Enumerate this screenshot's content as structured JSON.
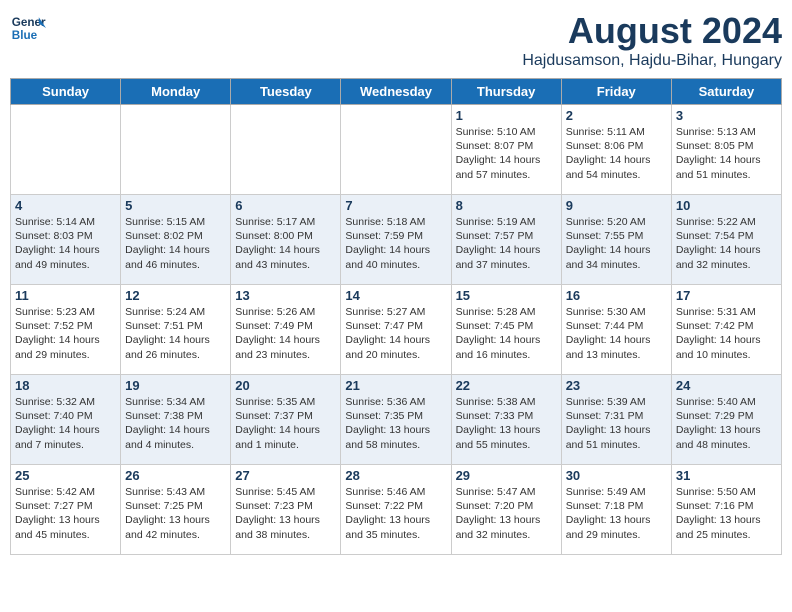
{
  "header": {
    "logo_line1": "General",
    "logo_line2": "Blue",
    "month_title": "August 2024",
    "location": "Hajdusamson, Hajdu-Bihar, Hungary"
  },
  "weekdays": [
    "Sunday",
    "Monday",
    "Tuesday",
    "Wednesday",
    "Thursday",
    "Friday",
    "Saturday"
  ],
  "weeks": [
    [
      {
        "day": "",
        "content": ""
      },
      {
        "day": "",
        "content": ""
      },
      {
        "day": "",
        "content": ""
      },
      {
        "day": "",
        "content": ""
      },
      {
        "day": "1",
        "content": "Sunrise: 5:10 AM\nSunset: 8:07 PM\nDaylight: 14 hours\nand 57 minutes."
      },
      {
        "day": "2",
        "content": "Sunrise: 5:11 AM\nSunset: 8:06 PM\nDaylight: 14 hours\nand 54 minutes."
      },
      {
        "day": "3",
        "content": "Sunrise: 5:13 AM\nSunset: 8:05 PM\nDaylight: 14 hours\nand 51 minutes."
      }
    ],
    [
      {
        "day": "4",
        "content": "Sunrise: 5:14 AM\nSunset: 8:03 PM\nDaylight: 14 hours\nand 49 minutes."
      },
      {
        "day": "5",
        "content": "Sunrise: 5:15 AM\nSunset: 8:02 PM\nDaylight: 14 hours\nand 46 minutes."
      },
      {
        "day": "6",
        "content": "Sunrise: 5:17 AM\nSunset: 8:00 PM\nDaylight: 14 hours\nand 43 minutes."
      },
      {
        "day": "7",
        "content": "Sunrise: 5:18 AM\nSunset: 7:59 PM\nDaylight: 14 hours\nand 40 minutes."
      },
      {
        "day": "8",
        "content": "Sunrise: 5:19 AM\nSunset: 7:57 PM\nDaylight: 14 hours\nand 37 minutes."
      },
      {
        "day": "9",
        "content": "Sunrise: 5:20 AM\nSunset: 7:55 PM\nDaylight: 14 hours\nand 34 minutes."
      },
      {
        "day": "10",
        "content": "Sunrise: 5:22 AM\nSunset: 7:54 PM\nDaylight: 14 hours\nand 32 minutes."
      }
    ],
    [
      {
        "day": "11",
        "content": "Sunrise: 5:23 AM\nSunset: 7:52 PM\nDaylight: 14 hours\nand 29 minutes."
      },
      {
        "day": "12",
        "content": "Sunrise: 5:24 AM\nSunset: 7:51 PM\nDaylight: 14 hours\nand 26 minutes."
      },
      {
        "day": "13",
        "content": "Sunrise: 5:26 AM\nSunset: 7:49 PM\nDaylight: 14 hours\nand 23 minutes."
      },
      {
        "day": "14",
        "content": "Sunrise: 5:27 AM\nSunset: 7:47 PM\nDaylight: 14 hours\nand 20 minutes."
      },
      {
        "day": "15",
        "content": "Sunrise: 5:28 AM\nSunset: 7:45 PM\nDaylight: 14 hours\nand 16 minutes."
      },
      {
        "day": "16",
        "content": "Sunrise: 5:30 AM\nSunset: 7:44 PM\nDaylight: 14 hours\nand 13 minutes."
      },
      {
        "day": "17",
        "content": "Sunrise: 5:31 AM\nSunset: 7:42 PM\nDaylight: 14 hours\nand 10 minutes."
      }
    ],
    [
      {
        "day": "18",
        "content": "Sunrise: 5:32 AM\nSunset: 7:40 PM\nDaylight: 14 hours\nand 7 minutes."
      },
      {
        "day": "19",
        "content": "Sunrise: 5:34 AM\nSunset: 7:38 PM\nDaylight: 14 hours\nand 4 minutes."
      },
      {
        "day": "20",
        "content": "Sunrise: 5:35 AM\nSunset: 7:37 PM\nDaylight: 14 hours\nand 1 minute."
      },
      {
        "day": "21",
        "content": "Sunrise: 5:36 AM\nSunset: 7:35 PM\nDaylight: 13 hours\nand 58 minutes."
      },
      {
        "day": "22",
        "content": "Sunrise: 5:38 AM\nSunset: 7:33 PM\nDaylight: 13 hours\nand 55 minutes."
      },
      {
        "day": "23",
        "content": "Sunrise: 5:39 AM\nSunset: 7:31 PM\nDaylight: 13 hours\nand 51 minutes."
      },
      {
        "day": "24",
        "content": "Sunrise: 5:40 AM\nSunset: 7:29 PM\nDaylight: 13 hours\nand 48 minutes."
      }
    ],
    [
      {
        "day": "25",
        "content": "Sunrise: 5:42 AM\nSunset: 7:27 PM\nDaylight: 13 hours\nand 45 minutes."
      },
      {
        "day": "26",
        "content": "Sunrise: 5:43 AM\nSunset: 7:25 PM\nDaylight: 13 hours\nand 42 minutes."
      },
      {
        "day": "27",
        "content": "Sunrise: 5:45 AM\nSunset: 7:23 PM\nDaylight: 13 hours\nand 38 minutes."
      },
      {
        "day": "28",
        "content": "Sunrise: 5:46 AM\nSunset: 7:22 PM\nDaylight: 13 hours\nand 35 minutes."
      },
      {
        "day": "29",
        "content": "Sunrise: 5:47 AM\nSunset: 7:20 PM\nDaylight: 13 hours\nand 32 minutes."
      },
      {
        "day": "30",
        "content": "Sunrise: 5:49 AM\nSunset: 7:18 PM\nDaylight: 13 hours\nand 29 minutes."
      },
      {
        "day": "31",
        "content": "Sunrise: 5:50 AM\nSunset: 7:16 PM\nDaylight: 13 hours\nand 25 minutes."
      }
    ]
  ]
}
